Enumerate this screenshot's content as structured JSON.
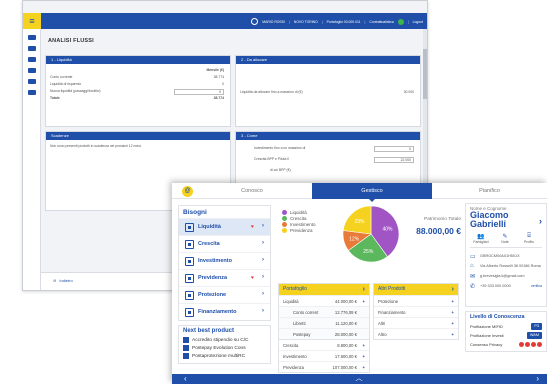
{
  "back": {
    "userbar": {
      "user": "MARIO ROSSI",
      "branch": "NOVO TORINO",
      "portfolio": "Portafoglio 00.000.011",
      "status": "Contrattualistica",
      "logout": "Logout"
    },
    "page_title": "ANALISI FLUSSI",
    "panels": {
      "liquidita": {
        "title": "1 - Liquidità",
        "col_header": "Mensile (€)",
        "rows": [
          {
            "label": "Conto corrente",
            "value": "38.774"
          },
          {
            "label": "Liquidità di risparmio",
            "value": "0"
          },
          {
            "label": "Nuova liquidità (passaggi/bonifici)",
            "value": "0"
          },
          {
            "label": "Totale",
            "value": "38.774"
          }
        ]
      },
      "da_allocare": {
        "title": "2 - Da allocare",
        "rows": [
          {
            "label": "Liquidità da allocare fino a massimo di (€)",
            "value": "30.000"
          }
        ]
      },
      "scadenze": {
        "title": "Scadenze",
        "text": "Non sono presenti prodotti in scadenza nei prossimi 12 mesi."
      },
      "come": {
        "title": "3 - Come",
        "rows": [
          {
            "label": "Investimento fino a un massimo di",
            "value": "0"
          },
          {
            "label": "Crescita BPP e Pilota II",
            "value": "22.000"
          },
          {
            "label": "di cui BPP (€)",
            "value": ""
          }
        ]
      }
    },
    "footer_label": "Indietro"
  },
  "front": {
    "tabs": [
      "Conosco",
      "Gestisco",
      "Pianifico"
    ],
    "active_tab": 1,
    "bisogni": {
      "title": "Bisogni",
      "items": [
        {
          "label": "Liquidità",
          "heart": true
        },
        {
          "label": "Crescita",
          "heart": false
        },
        {
          "label": "Investimento",
          "heart": false
        },
        {
          "label": "Previdenza",
          "heart": true
        },
        {
          "label": "Protezione",
          "heart": false
        },
        {
          "label": "Finanziamento",
          "heart": false
        }
      ]
    },
    "next_best": {
      "title": "Next best product",
      "items": [
        "Accredito stipendio su C/C",
        "Postepay Evolution Cons",
        "Postaprotezione multiRC"
      ]
    },
    "chart_data": {
      "type": "pie",
      "title": "",
      "legend": [
        {
          "name": "Liquidità",
          "color": "#a154c4"
        },
        {
          "name": "Crescita",
          "color": "#5cb85c"
        },
        {
          "name": "Investimento",
          "color": "#e87a3a"
        },
        {
          "name": "Previdenza",
          "color": "#f4d21f"
        }
      ],
      "series": [
        {
          "name": "Liquidità",
          "value": 40,
          "label": "40%",
          "color": "#a154c4"
        },
        {
          "name": "Crescita",
          "value": 25,
          "label": "25%",
          "color": "#5cb85c"
        },
        {
          "name": "Investimento",
          "value": 12,
          "label": "12%",
          "color": "#e87a3a"
        },
        {
          "name": "Previdenza",
          "value": 23,
          "label": "23%",
          "color": "#f4d21f"
        }
      ],
      "total_label": "Patrimonio Totale",
      "total_value": "88.000,00 €"
    },
    "portafoglio": {
      "title": "Portafoglio",
      "rows": [
        {
          "label": "Liquidità",
          "value": "44.000,00 €",
          "sub": false
        },
        {
          "label": "Conto corrent",
          "value": "12.776,08 €",
          "sub": true
        },
        {
          "label": "Libretti",
          "value": "11.120,00 €",
          "sub": true
        },
        {
          "label": "Postepay",
          "value": "28.000,00 €",
          "sub": true
        },
        {
          "label": "Crescita",
          "value": "8.800,00 €",
          "sub": false
        },
        {
          "label": "Investimento",
          "value": "17.600,00 €",
          "sub": false
        },
        {
          "label": "Previdenza",
          "value": "107.000,00 €",
          "sub": false
        }
      ]
    },
    "altri_prodotti": {
      "title": "Altri Prodotti",
      "rows": [
        "Protezione",
        "Finanziamento",
        "Altri",
        "Altro"
      ]
    },
    "customer": {
      "label": "Nome e Cognome",
      "first_name": "Giacomo",
      "last_name": "Gabrielli",
      "icons": [
        {
          "glyph": "👥",
          "text": "Famigliari"
        },
        {
          "glyph": "✎",
          "text": "Note"
        },
        {
          "glyph": "⌸",
          "text": "Profilo"
        }
      ],
      "contacts": [
        {
          "icon": "id-card-icon",
          "glyph": "▭",
          "text": "GBRGCM00A01H501X",
          "extra": ""
        },
        {
          "icon": "home-icon",
          "glyph": "⌂",
          "text": "Via Alberto Rosselli 38 00186 Roma",
          "extra": ""
        },
        {
          "icon": "mail-icon",
          "glyph": "✉",
          "text": "g.brevesigla.k@gmail.com",
          "extra": ""
        },
        {
          "icon": "phone-icon",
          "glyph": "✆",
          "text": "+39 333 000 0000",
          "extra": "verifica"
        }
      ]
    },
    "livello": {
      "title": "Livello di Conoscenza",
      "rows": [
        {
          "label": "Profilazione MIFID",
          "badge": "P3",
          "dots": false
        },
        {
          "label": "Profilazione Investi",
          "badge": "WAM",
          "dots": false
        },
        {
          "label": "Consenso Privacy",
          "badge": "",
          "dots": true
        }
      ],
      "dot_colors": [
        "#e53935",
        "#e53935",
        "#e53935",
        "#e53935"
      ]
    }
  }
}
